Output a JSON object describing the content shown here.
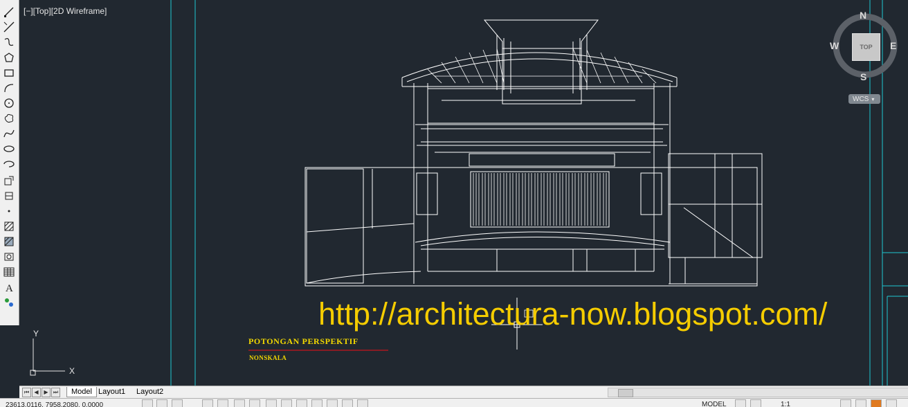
{
  "viewport": {
    "label": "[−][Top][2D Wireframe]",
    "watermark": "http://architectura-now.blogspot.com/",
    "drawing_title": "POTONGAN PERSPEKTIF",
    "drawing_subtitle": "NONSKALA",
    "ucs_axes": {
      "x": "X",
      "y": "Y"
    }
  },
  "viewcube": {
    "north": "N",
    "south": "S",
    "east": "E",
    "west": "W",
    "top_face": "TOP",
    "wcs": "WCS"
  },
  "tabs": {
    "model": "Model",
    "layout1": "Layout1",
    "layout2": "Layout2"
  },
  "status": {
    "coordinates": "23613.0116, 7958.2080, 0.0000",
    "space": "MODEL",
    "scale": "1:1"
  },
  "colors": {
    "background": "#212830",
    "watermark": "#f5cc00",
    "title": "#f2d800",
    "underline": "#c8141e",
    "grid_lines": "#1ec8d2",
    "linework": "#ffffff"
  },
  "toolbar_icons": [
    "line-icon",
    "polyline-icon",
    "construction-line-icon",
    "polygon-icon",
    "rectangle-icon",
    "arc-icon",
    "circle-icon",
    "revision-cloud-icon",
    "spline-icon",
    "ellipse-icon",
    "ellipse-arc-icon",
    "insert-block-icon",
    "make-block-icon",
    "point-icon",
    "hatch-icon",
    "gradient-icon",
    "region-icon",
    "table-icon",
    "multiline-text-icon",
    "add-selected-icon"
  ]
}
